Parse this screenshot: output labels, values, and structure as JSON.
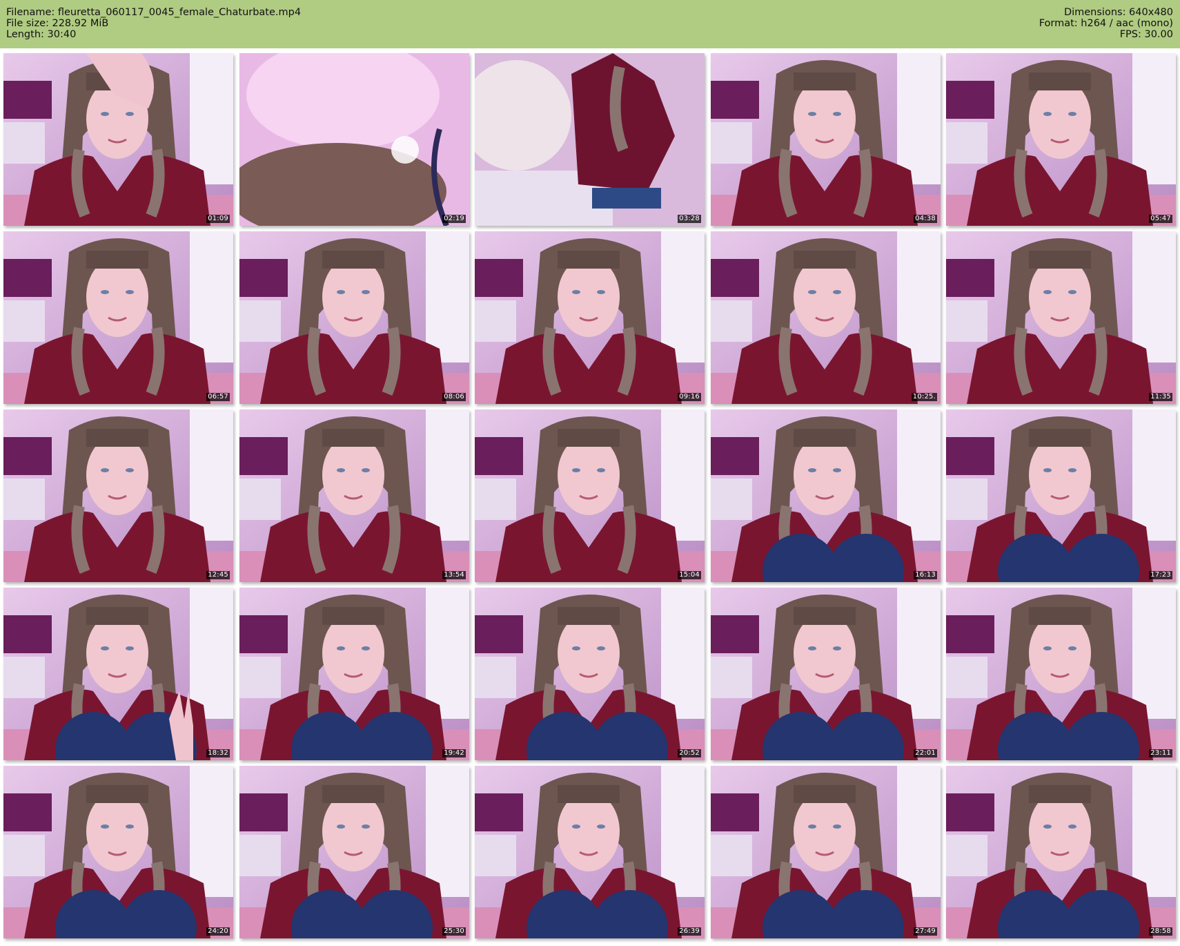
{
  "header": {
    "filename_line": "Filename: fleuretta_060117_0045_female_Chaturbate.mp4",
    "filesize_line": "File size: 228.92 MiB",
    "length_line": "Length: 30:40",
    "dimensions_line": "Dimensions: 640x480",
    "format_line": "Format: h264 / aac (mono)",
    "fps_line": "FPS: 30.00"
  },
  "colors": {
    "header_bg": "#b0cb82",
    "page_bg": "#ffffff",
    "timestamp_bg": "#000000",
    "timestamp_text": "#ffffff"
  },
  "thumbnails": [
    {
      "time": "01:09",
      "scene": "hand"
    },
    {
      "time": "02:19",
      "scene": "blur"
    },
    {
      "time": "03:28",
      "scene": "away"
    },
    {
      "time": "04:38",
      "scene": "face"
    },
    {
      "time": "05:47",
      "scene": "face"
    },
    {
      "time": "06:57",
      "scene": "face"
    },
    {
      "time": "08:06",
      "scene": "face"
    },
    {
      "time": "09:16",
      "scene": "face"
    },
    {
      "time": "10:25.",
      "scene": "face"
    },
    {
      "time": "11:35",
      "scene": "face"
    },
    {
      "time": "12:45",
      "scene": "face"
    },
    {
      "time": "13:54",
      "scene": "face"
    },
    {
      "time": "15:04",
      "scene": "face"
    },
    {
      "time": "16:13",
      "scene": "knees"
    },
    {
      "time": "17:23",
      "scene": "knees"
    },
    {
      "time": "18:32",
      "scene": "knees-hand"
    },
    {
      "time": "19:42",
      "scene": "knees"
    },
    {
      "time": "20:52",
      "scene": "knees"
    },
    {
      "time": "22:01",
      "scene": "knees"
    },
    {
      "time": "23:11",
      "scene": "knees"
    },
    {
      "time": "24:20",
      "scene": "knees"
    },
    {
      "time": "25:30",
      "scene": "knees"
    },
    {
      "time": "26:39",
      "scene": "knees"
    },
    {
      "time": "27:49",
      "scene": "knees"
    },
    {
      "time": "28:58",
      "scene": "knees"
    }
  ]
}
